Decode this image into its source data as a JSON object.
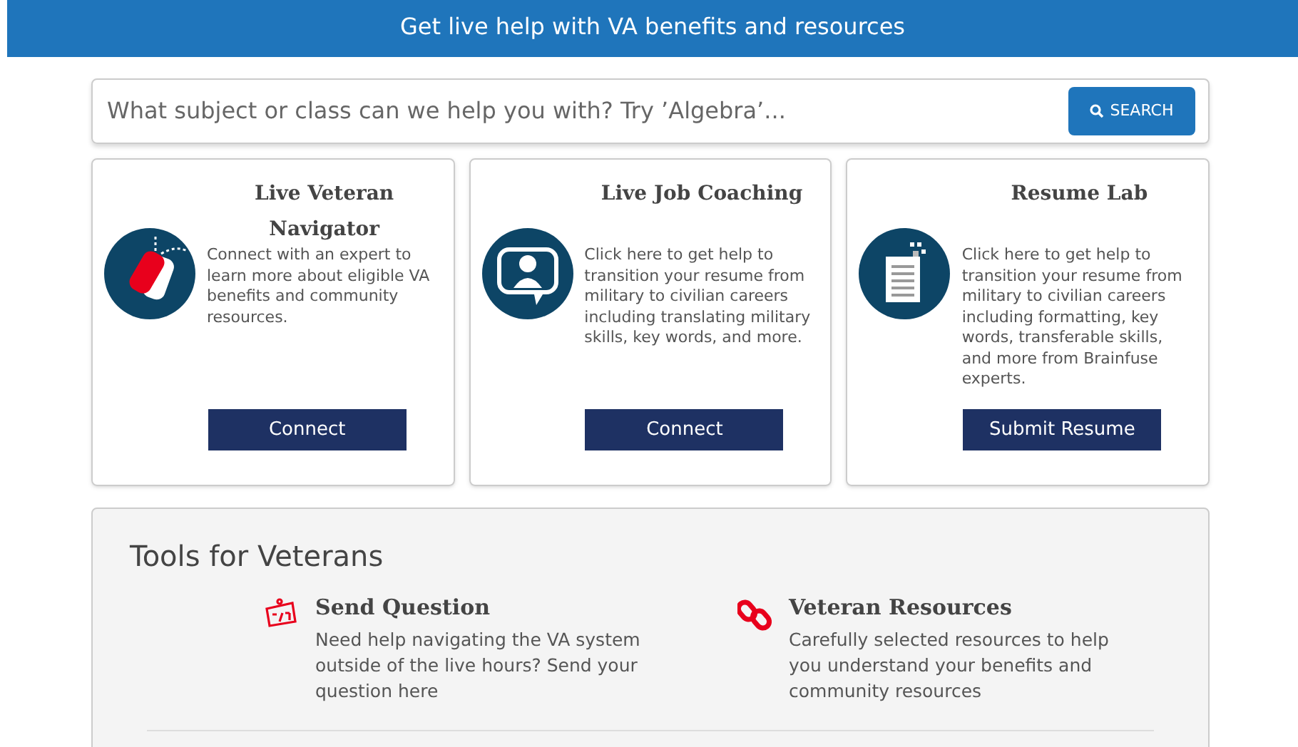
{
  "banner": {
    "title": "Get live help with VA benefits and resources"
  },
  "search": {
    "placeholder": "What subject or class can we help you with? Try ’Algebra’...",
    "button": "SEARCH"
  },
  "cards": [
    {
      "kind": "dogtag",
      "title": "Live Veteran Navigator",
      "description": "Connect with an expert to learn more about eligible VA benefits and community resources.",
      "button": "Connect"
    },
    {
      "kind": "coach",
      "title": "Live Job Coaching",
      "description": "Click here to get help to transition your resume from military to civilian careers including translating military skills, key words, and more.",
      "button": "Connect"
    },
    {
      "kind": "document",
      "title": "Resume Lab",
      "description": "Click here to get help to transition your resume from military to civilian careers including formatting, key words, transferable skills, and more from Brainfuse experts.",
      "button": "Submit Resume"
    }
  ],
  "tools": {
    "title": "Tools for Veterans",
    "items": [
      {
        "kind": "question",
        "title": "Send Question",
        "description": "Need help navigating the VA system outside of the live hours? Send your question here"
      },
      {
        "kind": "link",
        "title": "Veteran Resources",
        "description": "Carefully selected resources to help you understand your benefits and community resources"
      }
    ]
  }
}
